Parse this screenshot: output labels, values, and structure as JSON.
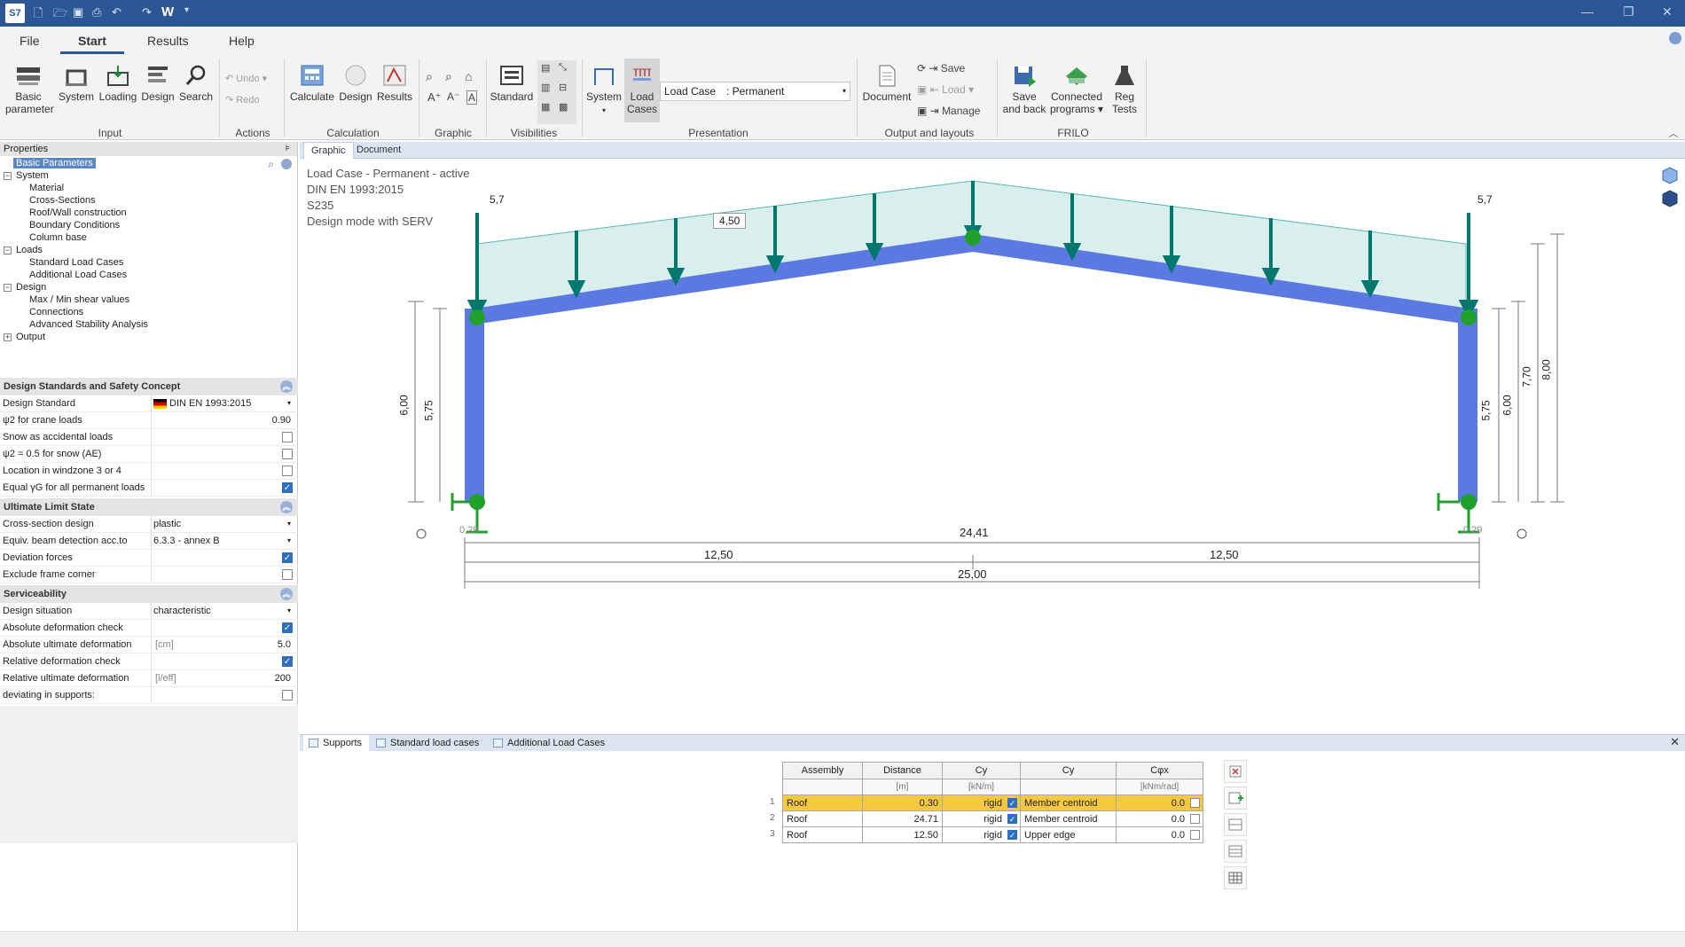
{
  "titlebar": {
    "app_icon": "S7",
    "w_label": "W"
  },
  "menu": {
    "file": "File",
    "start": "Start",
    "results": "Results",
    "help": "Help"
  },
  "ribbon": {
    "input": {
      "basic_line1": "Basic",
      "basic_line2": "parameter",
      "system": "System",
      "loading": "Loading",
      "design": "Design",
      "search": "Search",
      "group": "Input"
    },
    "actions": {
      "undo": "Undo",
      "redo": "Redo",
      "group": "Actions"
    },
    "calculation": {
      "calculate": "Calculate",
      "design": "Design",
      "results": "Results",
      "group": "Calculation"
    },
    "graphic": {
      "group": "Graphic"
    },
    "visibilities": {
      "standard": "Standard",
      "group": "Visibilities"
    },
    "presentation": {
      "system": "System",
      "load_line1": "Load",
      "load_line2": "Cases",
      "load_case_label": "Load Case",
      "load_case_value": ": Permanent",
      "group": "Presentation"
    },
    "output": {
      "document": "Document",
      "save": "Save",
      "load": "Load",
      "manage": "Manage",
      "group": "Output and layouts"
    },
    "frilo": {
      "save_line1": "Save",
      "save_line2": "and back",
      "connected_line1": "Connected",
      "connected_line2": "programs",
      "reg_line1": "Reg",
      "reg_line2": "Tests",
      "group": "FRILO"
    }
  },
  "properties": {
    "title": "Properties",
    "tree": {
      "basic": "Basic Parameters",
      "system": "System",
      "material": "Material",
      "cross_sections": "Cross-Sections",
      "roof_wall": "Roof/Wall construction",
      "boundary": "Boundary Conditions",
      "column_base": "Column  base",
      "loads": "Loads",
      "standard_lc": "Standard Load Cases",
      "additional_lc": "Additional Load Cases",
      "design": "Design",
      "shear": "Max / Min shear values",
      "connections": "Connections",
      "stability": "Advanced Stability Analysis",
      "output": "Output"
    },
    "sec1": {
      "title": "Design Standards and Safety Concept",
      "standard_label": "Design Standard",
      "standard_value": "DIN EN 1993:2015",
      "psi2_label": "ψ2 for crane loads",
      "psi2_value": "0.90",
      "snow_label": "Snow as accidental loads",
      "psi_snow_label": "ψ2 = 0.5 for snow (AE)",
      "windzone_label": "Location in windzone 3 or 4",
      "gamma_label": "Equal γG for all permanent loads"
    },
    "sec2": {
      "title": "Ultimate Limit State",
      "cs_label": "Cross-section design",
      "cs_value": "plastic",
      "equiv_label": "Equiv. beam detection acc.to",
      "equiv_value": "6.3.3 - annex B",
      "deviation_label": "Deviation forces",
      "exclude_label": "Exclude frame corner"
    },
    "sec3": {
      "title": "Serviceability",
      "situation_label": "Design situation",
      "situation_value": "characteristic",
      "abs_check_label": "Absolute deformation check",
      "abs_ult_label": "Absolute ultimate deformation",
      "abs_ult_unit": "[cm]",
      "abs_ult_value": "5.0",
      "rel_check_label": "Relative deformation check",
      "rel_ult_label": "Relative ultimate deformation",
      "rel_ult_unit": "[l/eff]",
      "rel_ult_value": "200",
      "deviating_label": "deviating in supports:"
    }
  },
  "view_tabs": {
    "graphic": "Graphic",
    "document": "Document"
  },
  "canvas": {
    "line1": "Load Case - Permanent - active",
    "line2": "DIN EN 1993:2015",
    "line3": "S235",
    "line4": "Design mode with SERV",
    "load_left": "5,7",
    "load_right": "5,7",
    "load_box": "4,50",
    "dim_600_left": "6,00",
    "dim_575_left": "5,75",
    "dim_575_right": "5,75",
    "dim_600_right": "6,00",
    "dim_770": "7,70",
    "dim_800": "8,00",
    "dim_029_left": "0,29",
    "dim_029_right": "0,29",
    "dim_2441": "24,41",
    "dim_1250_left": "12,50",
    "dim_1250_right": "12,50",
    "dim_2500": "25,00"
  },
  "bottom_tabs": {
    "supports": "Supports",
    "standard": "Standard load cases",
    "additional": "Additional Load Cases"
  },
  "supports_table": {
    "headers": [
      "Assembly",
      "Distance",
      "Cy",
      "Cy",
      "Cφx"
    ],
    "units": [
      "",
      "[m]",
      "[kN/m]",
      "",
      "[kNm/rad]"
    ],
    "rows": [
      {
        "n": "1",
        "assembly": "Roof",
        "distance": "0.30",
        "cy": "rigid",
        "pos": "Member centroid",
        "cphi": "0.0"
      },
      {
        "n": "2",
        "assembly": "Roof",
        "distance": "24.71",
        "cy": "rigid",
        "pos": "Member centroid",
        "cphi": "0.0"
      },
      {
        "n": "3",
        "assembly": "Roof",
        "distance": "12.50",
        "cy": "rigid",
        "pos": "Upper edge",
        "cphi": "0.0"
      }
    ]
  },
  "colors": {
    "titlebar": "#2b5797",
    "frame": "#5b79e0",
    "load_fill": "#d8efee",
    "load_arrow": "#00786e",
    "node": "#1fa12c",
    "highlight": "#f5c842"
  }
}
